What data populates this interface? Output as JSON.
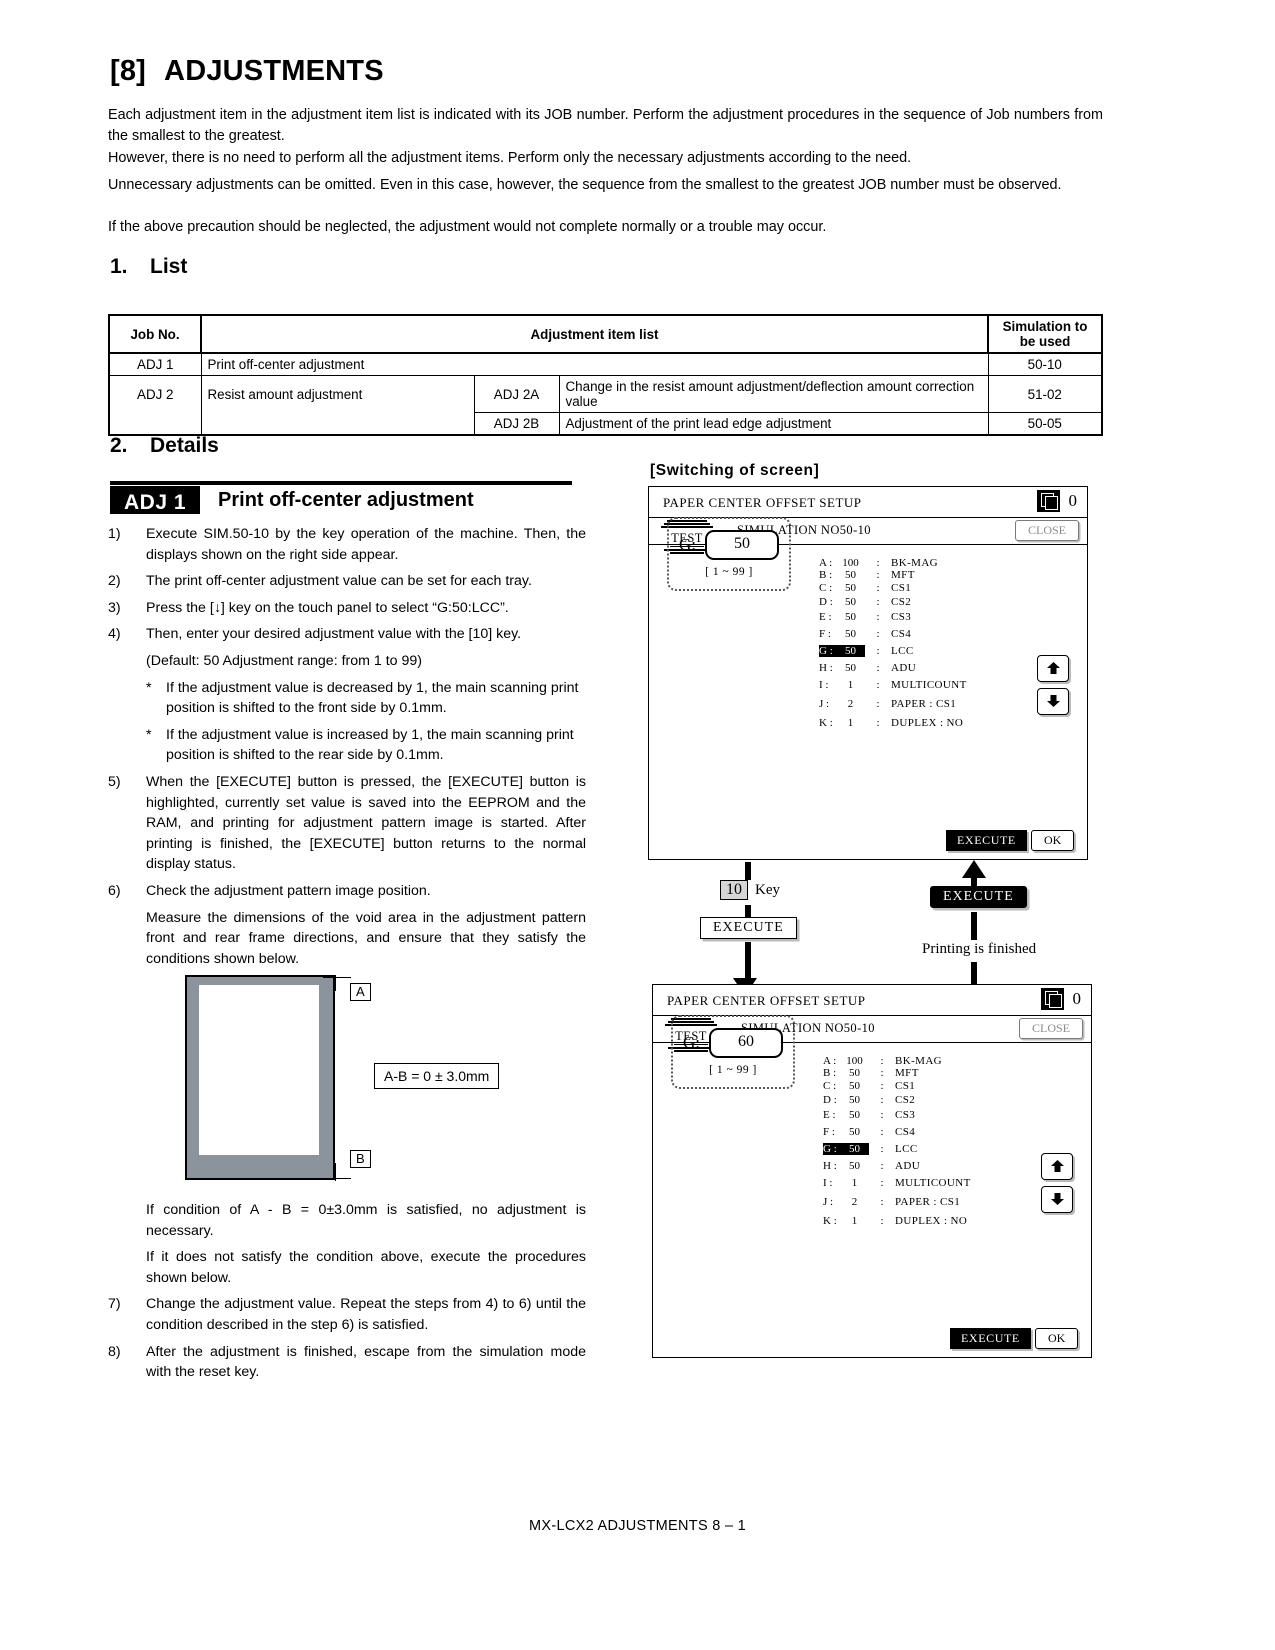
{
  "doc": {
    "chapter_number": "[8]",
    "chapter_title": "ADJUSTMENTS",
    "intro": [
      "Each adjustment item in the adjustment item list is indicated with its JOB number. Perform the adjustment procedures in the sequence of Job numbers from the smallest to the greatest.",
      "However, there is no need to perform all the adjustment items. Perform only the necessary adjustments according to the need.",
      "Unnecessary adjustments can be omitted. Even in this case, however, the sequence from the smallest to the greatest JOB number must be observed.",
      "If the above precaution should be neglected, the adjustment would not complete normally or a trouble may occur."
    ],
    "section1_num": "1.",
    "section1_title": "List",
    "section2_num": "2.",
    "section2_title": "Details",
    "footer": "MX-LCX2  ADJUSTMENTS  8 – 1"
  },
  "list_table": {
    "headers": {
      "job_no": "Job No.",
      "item_list": "Adjustment item list",
      "simulation_l1": "Simulation to",
      "simulation_l2": "be used"
    },
    "rows": [
      {
        "job": "ADJ 1",
        "item": "Print off-center adjustment",
        "sub_code": "",
        "sub_item": "",
        "sim": "50-10"
      },
      {
        "job": "ADJ 2",
        "item": "Resist amount adjustment",
        "sub_code": "ADJ 2A",
        "sub_item": "Change in the resist amount adjustment/deflection amount correction value",
        "sim": "51-02"
      },
      {
        "job": "",
        "item": "",
        "sub_code": "ADJ 2B",
        "sub_item": "Adjustment of the print lead edge adjustment",
        "sim": "50-05"
      }
    ]
  },
  "adj1": {
    "tag": "ADJ 1",
    "title": "Print off-center adjustment",
    "steps": [
      {
        "mark": "1)",
        "text": "Execute SIM.50-10 by the key operation of the machine. Then, the displays shown on the right side appear."
      },
      {
        "mark": "2)",
        "text": "The print off-center adjustment value can be set for each tray."
      },
      {
        "mark": "3)",
        "text": "Press the [↓] key on the touch panel to select “G:50:LCC”."
      },
      {
        "mark": "4)",
        "text": "Then, enter your desired adjustment value with the [10] key."
      }
    ],
    "step4_note": "(Default: 50    Adjustment range: from 1 to 99)",
    "star1": "If the adjustment value is decreased by 1, the main scanning print position is shifted to the front side by 0.1mm.",
    "star2": "If the adjustment value is increased by 1, the main scanning print position is shifted to the rear side by 0.1mm.",
    "star_mark": "*",
    "step5": {
      "mark": "5)",
      "text": "When the [EXECUTE] button is pressed, the [EXECUTE] button is highlighted, currently set value is saved into the EEPROM and the RAM, and printing for adjustment pattern image is started. After printing is finished, the [EXECUTE] button returns to the normal display status."
    },
    "step6": {
      "mark": "6)",
      "text": "Check the adjustment pattern image position."
    },
    "step6_note": "Measure the dimensions of the void area in the adjustment pattern front and rear frame directions, and ensure that they satisfy the conditions shown below.",
    "after_fig_1": "If condition of A - B = 0±3.0mm is satisfied, no adjustment is necessary.",
    "after_fig_2": "If it does not satisfy the condition above, execute the procedures shown below.",
    "step7": {
      "mark": "7)",
      "text": "Change the adjustment value. Repeat the steps from 4) to 6) until the condition described in the step 6) is satisfied."
    },
    "step8": {
      "mark": "8)",
      "text": "After the adjustment is finished, escape from the simulation mode with the reset key."
    }
  },
  "figure": {
    "label_a": "A",
    "label_b": "B",
    "formula": "A-B = 0 ± 3.0mm"
  },
  "flow": {
    "switching_label": "[Switching  of  screen]",
    "key_chip_value": "10",
    "key_chip_word": "Key",
    "execute_label": "EXECUTE",
    "execute_pressed_label": "EXECUTE",
    "printing_finished": "Printing is finished"
  },
  "panel_top": {
    "counter": "0",
    "test_label": "TEST",
    "sim_title": "SIMULATION  NO50-10",
    "close_label": "CLOSE",
    "setup_label": "PAPER CENTER OFFSET SETUP",
    "g_label": "G:",
    "g_value": "50",
    "g_range": "[  1 ~ 99  ]",
    "params": [
      {
        "key": "A :",
        "value": "100",
        "sep": ":",
        "name": "BK-MAG",
        "selected": false
      },
      {
        "key": "B :",
        "value": "50",
        "sep": ":",
        "name": "MFT",
        "selected": false
      },
      {
        "key": "C :",
        "value": "50",
        "sep": ":",
        "name": "CS1",
        "selected": false
      },
      {
        "key": "D :",
        "value": "50",
        "sep": ":",
        "name": "CS2",
        "selected": false
      },
      {
        "key": "E :",
        "value": "50",
        "sep": ":",
        "name": "CS3",
        "selected": false
      },
      {
        "key": "F :",
        "value": "50",
        "sep": ":",
        "name": "CS4",
        "selected": false
      },
      {
        "key": "G :",
        "value": "50",
        "sep": ":",
        "name": "LCC",
        "selected": true
      },
      {
        "key": "H :",
        "value": "50",
        "sep": ":",
        "name": "ADU",
        "selected": false
      },
      {
        "key": "I :",
        "value": "1",
        "sep": ":",
        "name": "MULTICOUNT",
        "selected": false
      },
      {
        "key": "J :",
        "value": "2",
        "sep": ":",
        "name": "PAPER : CS1",
        "selected": false
      },
      {
        "key": "K :",
        "value": "1",
        "sep": ":",
        "name": "DUPLEX : NO",
        "selected": false
      }
    ],
    "execute_label": "EXECUTE",
    "ok_label": "OK"
  },
  "panel_bottom": {
    "counter": "0",
    "test_label": "TEST",
    "sim_title": "SIMULATION  NO50-10",
    "close_label": "CLOSE",
    "setup_label": "PAPER CENTER OFFSET SETUP",
    "g_label": "G:",
    "g_value": "60",
    "g_range": "[  1 ~ 99  ]",
    "params": [
      {
        "key": "A :",
        "value": "100",
        "sep": ":",
        "name": "BK-MAG",
        "selected": false
      },
      {
        "key": "B :",
        "value": "50",
        "sep": ":",
        "name": "MFT",
        "selected": false
      },
      {
        "key": "C :",
        "value": "50",
        "sep": ":",
        "name": "CS1",
        "selected": false
      },
      {
        "key": "D :",
        "value": "50",
        "sep": ":",
        "name": "CS2",
        "selected": false
      },
      {
        "key": "E :",
        "value": "50",
        "sep": ":",
        "name": "CS3",
        "selected": false
      },
      {
        "key": "F :",
        "value": "50",
        "sep": ":",
        "name": "CS4",
        "selected": false
      },
      {
        "key": "G :",
        "value": "50",
        "sep": ":",
        "name": "LCC",
        "selected": true
      },
      {
        "key": "H :",
        "value": "50",
        "sep": ":",
        "name": "ADU",
        "selected": false
      },
      {
        "key": "I :",
        "value": "1",
        "sep": ":",
        "name": "MULTICOUNT",
        "selected": false
      },
      {
        "key": "J :",
        "value": "2",
        "sep": ":",
        "name": "PAPER : CS1",
        "selected": false
      },
      {
        "key": "K :",
        "value": "1",
        "sep": ":",
        "name": "DUPLEX : NO",
        "selected": false
      }
    ],
    "execute_label": "EXECUTE",
    "ok_label": "OK"
  }
}
